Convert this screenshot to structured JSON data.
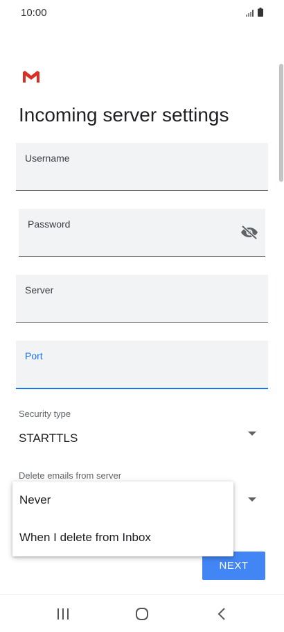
{
  "status_bar": {
    "time": "10:00",
    "signal_icon": "signal-icon",
    "battery_icon": "battery-icon"
  },
  "brand": {
    "logo_icon": "gmail-logo-icon",
    "color": "#d93025"
  },
  "title": "Incoming server settings",
  "fields": {
    "username": {
      "label": "Username",
      "value": ""
    },
    "password": {
      "label": "Password",
      "value": "",
      "toggle_icon": "visibility-off-icon"
    },
    "server": {
      "label": "Server",
      "value": ""
    },
    "port": {
      "label": "Port",
      "value": "",
      "focused": true
    }
  },
  "security_type": {
    "label": "Security type",
    "value": "STARTTLS"
  },
  "delete_emails": {
    "label": "Delete emails from server",
    "options": [
      "Never",
      "When I delete from Inbox"
    ]
  },
  "next_button": {
    "label": "NEXT",
    "color": "#4285f4"
  },
  "accent_color": "#1a73e8",
  "nav_bar": {
    "recents_icon": "recents-icon",
    "home_icon": "home-icon",
    "back_icon": "back-icon"
  }
}
